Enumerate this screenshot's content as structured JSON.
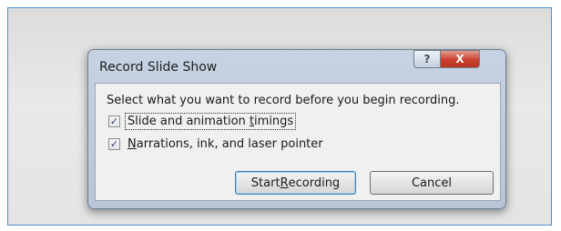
{
  "dialog": {
    "title": "Record Slide Show",
    "help_glyph": "?",
    "close_glyph": "X"
  },
  "content": {
    "prompt": "Select what you want to record before you begin recording.",
    "options": [
      {
        "label_before": "Slide and animation ",
        "mnemonic": "t",
        "label_after": "imings",
        "checked": true
      },
      {
        "label_before": "",
        "mnemonic": "N",
        "label_after": "arrations, ink, and laser pointer",
        "checked": true
      }
    ],
    "buttons": {
      "start": {
        "before": "Start ",
        "mnemonic": "R",
        "after": "ecording"
      },
      "cancel": "Cancel"
    },
    "check_glyph": "✓"
  },
  "colors": {
    "frame_border": "#4a90d0",
    "close_button": "#c9412e",
    "default_button_border": "#3c7fb1"
  }
}
